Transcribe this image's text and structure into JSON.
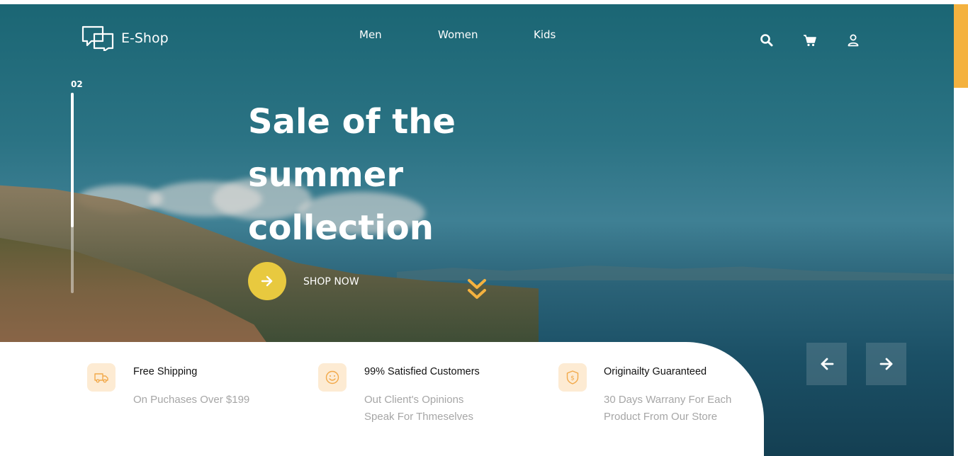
{
  "brand": {
    "name": "E-Shop",
    "icon": "chat-bubbles-icon"
  },
  "nav": {
    "items": [
      {
        "label": "Men"
      },
      {
        "label": "Women"
      },
      {
        "label": "Kids"
      }
    ]
  },
  "header_icons": [
    "search-icon",
    "cart-icon",
    "user-icon"
  ],
  "slider": {
    "current": "02",
    "progress": 0.67
  },
  "hero": {
    "headline_lines": [
      "Sale of the",
      "summer",
      "collection"
    ],
    "cta_label": "SHOP NOW",
    "cta_icon": "arrow-right-icon",
    "scroll_icon": "double-chevron-down-icon"
  },
  "features": [
    {
      "icon": "truck-icon",
      "title": "Free Shipping",
      "desc": [
        "On Puchases Over $199"
      ]
    },
    {
      "icon": "smile-icon",
      "title": "99% Satisfied Customers",
      "desc": [
        "Out Client's Opinions",
        "Speak For Thmeselves"
      ]
    },
    {
      "icon": "shield-dollar-icon",
      "title": "Originailty Guaranteed",
      "desc": [
        "30 Days Warrany For Each",
        "Product From Our Store"
      ]
    }
  ],
  "colors": {
    "accent_yellow": "#e8c93f",
    "accent_orange": "#f4b23f",
    "feature_icon_bg": "#fdebd3"
  }
}
